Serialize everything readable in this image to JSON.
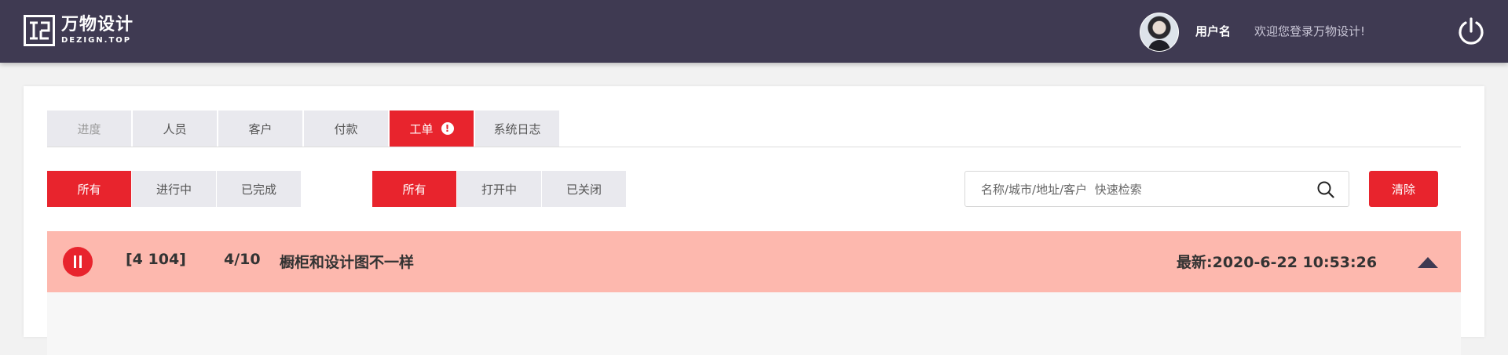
{
  "header": {
    "logo_cn": "万物设计",
    "logo_en": "DEZIGN.TOP",
    "username": "用户名",
    "welcome": "欢迎您登录万物设计!",
    "icons": {
      "logo": "logo-mark",
      "avatar": "avatar",
      "power": "power-icon"
    }
  },
  "tabs": [
    {
      "label": "进度",
      "state": "muted"
    },
    {
      "label": "人员",
      "state": "normal"
    },
    {
      "label": "客户",
      "state": "normal"
    },
    {
      "label": "付款",
      "state": "normal"
    },
    {
      "label": "工单",
      "state": "active",
      "alert_icon": "!"
    },
    {
      "label": "系统日志",
      "state": "normal"
    }
  ],
  "filters": {
    "progress": [
      "所有",
      "进行中",
      "已完成"
    ],
    "progress_selected": "所有",
    "status": [
      "所有",
      "打开中",
      "已关闭"
    ],
    "status_selected": "所有"
  },
  "search": {
    "placeholder": "名称/城市/地址/客户  快速检索",
    "value": "",
    "icon": "search-icon"
  },
  "clear_label": "清除",
  "order": {
    "id": "[4 104]",
    "progress": "4/10",
    "title": "橱柜和设计图不一样",
    "latest": "最新:2020-6-22   10:53:26",
    "icons": {
      "pause": "pause-icon",
      "collapse": "chevron-up-icon"
    }
  },
  "colors": {
    "header_bg": "#3f3a52",
    "accent_red": "#e8242d",
    "row_bg": "#fdb8ae",
    "tab_bg": "#e9e9ee"
  }
}
